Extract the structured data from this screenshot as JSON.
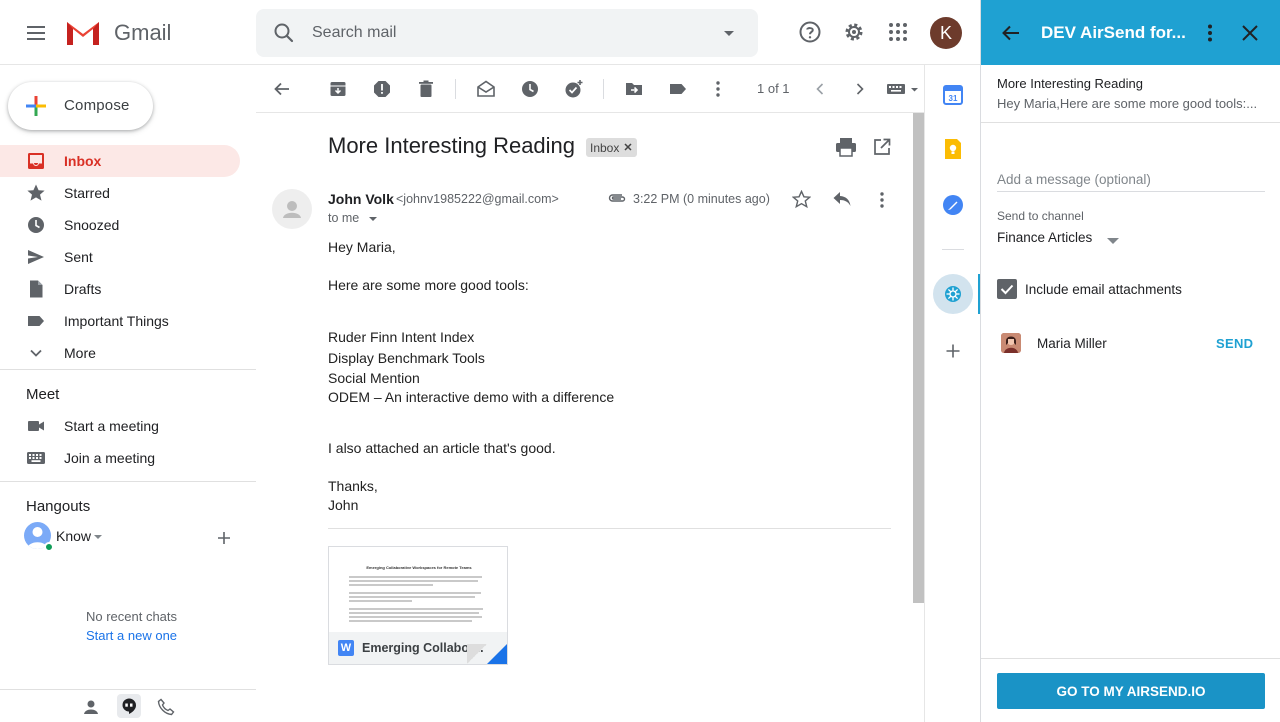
{
  "header": {
    "app_name": "Gmail",
    "search_placeholder": "Search mail",
    "avatar_initial": "K",
    "icons": [
      "menu-icon",
      "help-icon",
      "settings-icon",
      "apps-icon"
    ]
  },
  "sidebar": {
    "compose_label": "Compose",
    "items": [
      {
        "label": "Inbox",
        "icon": "inbox-icon",
        "active": true
      },
      {
        "label": "Starred",
        "icon": "star-icon"
      },
      {
        "label": "Snoozed",
        "icon": "clock-icon"
      },
      {
        "label": "Sent",
        "icon": "send-icon"
      },
      {
        "label": "Drafts",
        "icon": "draft-icon"
      },
      {
        "label": "Important Things",
        "icon": "label-icon"
      },
      {
        "label": "More",
        "icon": "chevron-down-icon"
      }
    ],
    "meet": {
      "title": "Meet",
      "items": [
        {
          "label": "Start a meeting",
          "icon": "video-icon"
        },
        {
          "label": "Join a meeting",
          "icon": "keyboard-icon"
        }
      ]
    },
    "hangouts": {
      "title": "Hangouts",
      "user": "Know",
      "no_chats": "No recent chats",
      "start_new": "Start a new one"
    }
  },
  "toolbar": {
    "pager": "1 of 1"
  },
  "email": {
    "subject": "More Interesting Reading",
    "label_chip": "Inbox",
    "sender_name": "John Volk",
    "sender_email": "<johnv1985222@gmail.com>",
    "to": "to me",
    "time": "3:22 PM (0 minutes ago)",
    "body": [
      "Hey Maria,",
      "Here are some more good tools:",
      "Ruder Finn Intent Index",
      "Display Benchmark Tools",
      "Social Mention",
      "ODEM – An interactive demo with a difference",
      "I also attached an article that's good.",
      "Thanks,",
      "John"
    ],
    "attachment": {
      "name": "Emerging Collabor...",
      "doc_title": "Emerging Collaborative Workspaces for Remote Teams"
    }
  },
  "addon": {
    "title": "DEV AirSend for...",
    "subject": "More Interesting Reading",
    "preview": "Hey Maria,Here are some more good tools:...",
    "message_placeholder": "Add a message (optional)",
    "channel_label": "Send to channel",
    "channel_value": "Finance Articles",
    "include_attachments_label": "Include email attachments",
    "include_attachments_checked": true,
    "member_name": "Maria Miller",
    "send_label": "SEND",
    "go_button": "GO TO MY AIRSEND.IO"
  },
  "colors": {
    "gmail_red": "#d93025",
    "inbox_active_bg": "#fce8e6",
    "airsend_blue": "#1fa1d2",
    "link_blue": "#1a73e8"
  }
}
